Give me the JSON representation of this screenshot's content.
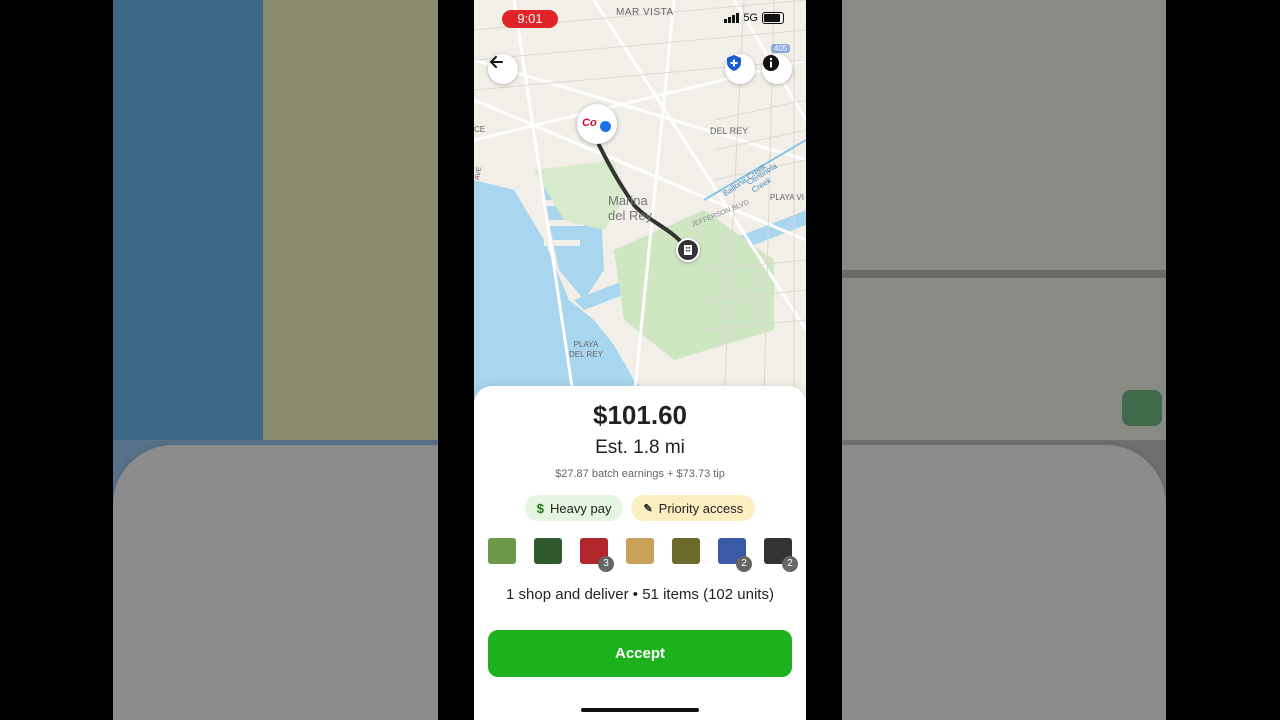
{
  "status_bar": {
    "time": "9:01",
    "network": "5G"
  },
  "map": {
    "labels": {
      "mar_vista": "MAR VISTA",
      "del_rey_north": "DEL REY",
      "marina_line1": "Marina",
      "marina_line2": "del Rey",
      "playa_del_rey_line1": "PLAYA",
      "playa_del_rey_line2": "DEL REY",
      "playa_vista": "PLAYA VI",
      "jefferson": "JEFFERSON BLVD",
      "ballona": "Ballona Creek",
      "centinela": "Centinela Creek",
      "highway": "405",
      "store_logo": "Co",
      "left_edge_1": "CE",
      "left_edge_2": "AVE"
    }
  },
  "offer": {
    "amount": "$101.60",
    "distance": "Est. 1.8 mi",
    "breakdown": "$27.87 batch earnings + $73.73 tip",
    "tags": [
      {
        "label": "Heavy pay",
        "icon": "dollar-icon",
        "color": "#e4f6e0"
      },
      {
        "label": "Priority access",
        "icon": "pen-icon",
        "color": "#fbefc2"
      }
    ],
    "products": [
      {
        "name": "product-1",
        "count": "",
        "color": "#6a9a4a"
      },
      {
        "name": "product-2",
        "count": "",
        "color": "#2e5a2e"
      },
      {
        "name": "product-3",
        "count": "3",
        "color": "#b0262a"
      },
      {
        "name": "product-4",
        "count": "",
        "color": "#c9a15a"
      },
      {
        "name": "product-5",
        "count": "",
        "color": "#6b6a2a"
      },
      {
        "name": "product-6",
        "count": "2",
        "color": "#3a5aa8"
      },
      {
        "name": "product-7",
        "count": "2",
        "color": "#333333"
      },
      {
        "name": "product-8",
        "count": "",
        "color": "#555555"
      }
    ],
    "summary": "1 shop and deliver • 51 items (102 units)",
    "accept_label": "Accept"
  },
  "colors": {
    "accent": "#1db11d",
    "status_pill": "#e3232a"
  }
}
